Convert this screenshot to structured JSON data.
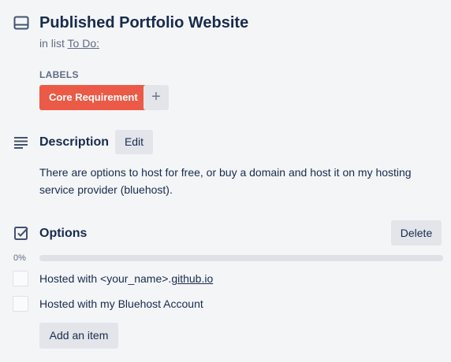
{
  "card": {
    "title": "Published Portfolio Website",
    "in_list_prefix": "in list",
    "list_name": "To Do:"
  },
  "labels": {
    "heading": "LABELS",
    "items": [
      {
        "text": "Core Requirement",
        "color": "#eb5a46"
      }
    ],
    "add_symbol": "+"
  },
  "description": {
    "title": "Description",
    "edit_label": "Edit",
    "text": "There are options to host for free, or buy a domain and host it on my hosting service provider (bluehost)."
  },
  "checklist": {
    "title": "Options",
    "delete_label": "Delete",
    "progress_label": "0%",
    "progress_fraction": 0,
    "items": [
      {
        "text_prefix": "Hosted with <your_name>.",
        "text_link": "github.io",
        "checked": false
      },
      {
        "text": "Hosted with my Bluehost Account",
        "checked": false
      }
    ],
    "add_label": "Add an item"
  },
  "icons": [
    "card-icon",
    "description-icon",
    "checklist-icon",
    "plus-icon",
    "checkbox-icon"
  ],
  "colors": {
    "label_red": "#eb5a46",
    "button_gray": "#e3e5ea",
    "text_dark": "#172b4d",
    "text_muted": "#5e6c84"
  }
}
